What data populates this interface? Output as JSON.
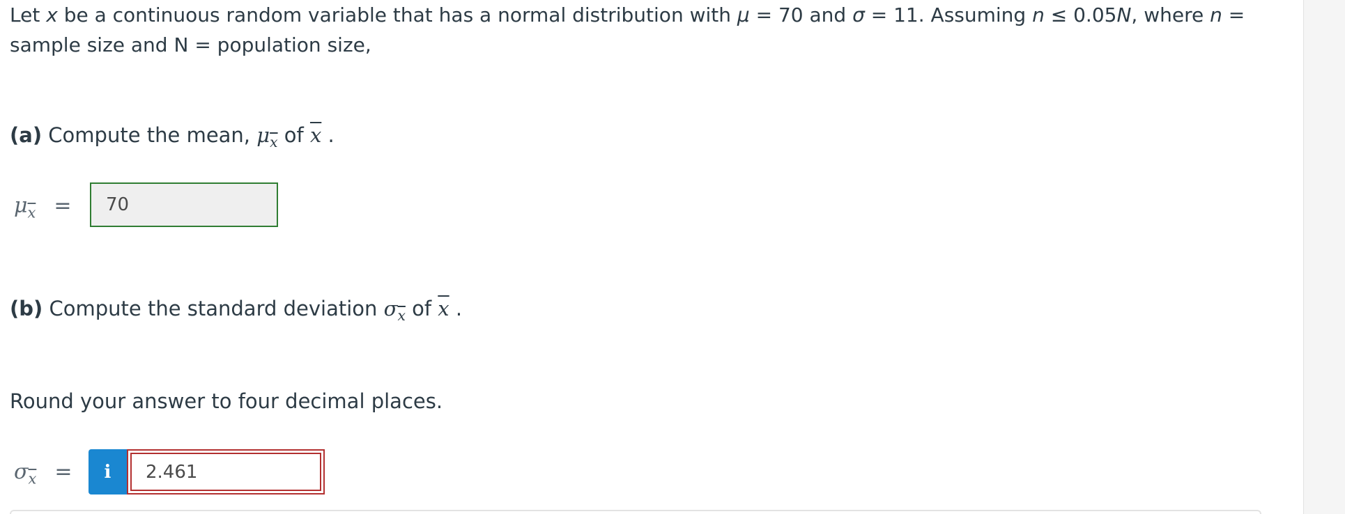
{
  "problem": {
    "intro_parts": {
      "t1": "Let ",
      "x": "x",
      "t2": " be a continuous random variable that has a normal distribution with ",
      "mu": "μ",
      "t3": " = 70 and ",
      "sigma": "σ",
      "t4": " = 11. Assuming ",
      "n": "n",
      "t5": " ≤ 0.05",
      "N": "N",
      "t6": ", where ",
      "n2": "n",
      "t7": " = sample size and N = population size,"
    }
  },
  "part_a": {
    "letter": "(a)",
    "text": " Compute the mean, ",
    "symbol": "μ",
    "sub": "x",
    "of": " of ",
    "xbar": "x",
    "end": " .",
    "answer_label_symbol": "μ",
    "answer_label_sub": "x",
    "answer_label_eq": "=",
    "answer_value": "70"
  },
  "part_b": {
    "letter": "(b)",
    "text": " Compute the standard deviation ",
    "symbol": "σ",
    "sub": "x",
    "of": " of ",
    "xbar": "x",
    "end": " .",
    "instruction": "Round your answer to four decimal places.",
    "answer_label_symbol": "σ",
    "answer_label_sub": "x",
    "answer_label_eq": "=",
    "info_button_label": "i",
    "answer_value": "2.461"
  },
  "colors": {
    "text": "#2d3b45",
    "correct_border": "#2f7d32",
    "incorrect_border": "#b33030",
    "info_button": "#1a87d1"
  },
  "icons": {
    "info": "info-icon"
  }
}
